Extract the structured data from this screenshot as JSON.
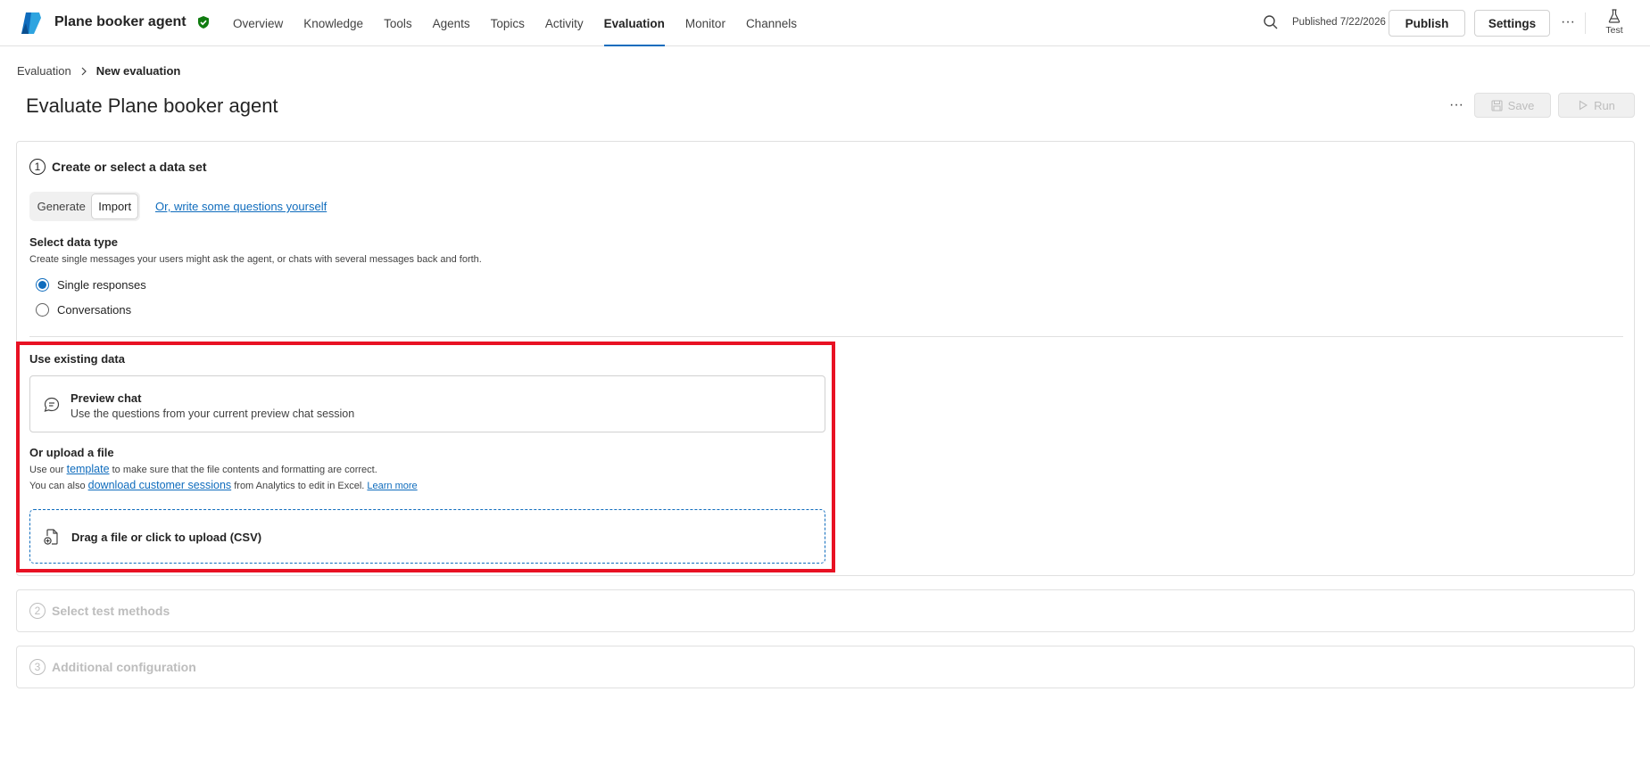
{
  "app": {
    "title": "Plane booker agent",
    "brand_color": "#0f6cbd"
  },
  "nav": {
    "tabs": [
      {
        "label": "Overview",
        "active": false
      },
      {
        "label": "Knowledge",
        "active": false
      },
      {
        "label": "Tools",
        "active": false
      },
      {
        "label": "Agents",
        "active": false
      },
      {
        "label": "Topics",
        "active": false
      },
      {
        "label": "Activity",
        "active": false
      },
      {
        "label": "Evaluation",
        "active": true
      },
      {
        "label": "Monitor",
        "active": false
      },
      {
        "label": "Channels",
        "active": false
      }
    ]
  },
  "header": {
    "published": "Published 7/22/2026",
    "publish_label": "Publish",
    "settings_label": "Settings",
    "more_label": "···",
    "test_label": "Test"
  },
  "breadcrumb": {
    "parent": "Evaluation",
    "current": "New evaluation"
  },
  "page": {
    "title": "Evaluate Plane booker agent",
    "more_label": "···",
    "save_label": "Save",
    "run_label": "Run"
  },
  "step1": {
    "number": "1",
    "title": "Create or select a data set",
    "tabs": {
      "generate": "Generate",
      "import": "Import"
    },
    "write_link": "Or, write some questions yourself",
    "data_type_label": "Select data type",
    "data_type_hint": "Create single messages your users might ask the agent, or chats with several messages back and forth.",
    "options": [
      {
        "label": "Single responses",
        "checked": true
      },
      {
        "label": "Conversations",
        "checked": false
      }
    ],
    "existing_label": "Use existing data",
    "preview": {
      "title": "Preview chat",
      "description": "Use the questions from your current preview chat session"
    },
    "upload_label": "Or upload a file",
    "hint1": {
      "pre": "Use our",
      "link": "template",
      "post": "to make sure that the file contents and formatting are correct."
    },
    "hint2": {
      "pre": "You can also",
      "link": "download customer sessions",
      "mid": "from Analytics to edit in Excel.",
      "learn": "Learn more"
    },
    "upload_zone": "Drag a file or click to upload (CSV)"
  },
  "step2": {
    "number": "2",
    "title": "Select test methods"
  },
  "step3": {
    "number": "3",
    "title": "Additional configuration"
  }
}
